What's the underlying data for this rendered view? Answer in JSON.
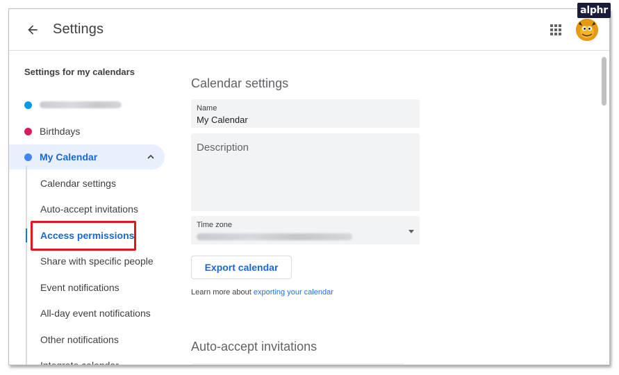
{
  "header": {
    "title": "Settings"
  },
  "sidebar": {
    "heading": "Settings for my calendars",
    "calendars": [
      {
        "label": "",
        "color": "#039be5",
        "blurred": true
      },
      {
        "label": "Birthdays",
        "color": "#d81b60",
        "blurred": false
      },
      {
        "label": "My Calendar",
        "color": "#4285f4",
        "blurred": false,
        "expanded": true
      }
    ],
    "sub_items": [
      "Calendar settings",
      "Auto-accept invitations",
      "Access permissions",
      "Share with specific people",
      "Event notifications",
      "All-day event notifications",
      "Other notifications",
      "Integrate calendar"
    ],
    "active_sub_item": "Access permissions"
  },
  "main": {
    "section_title": "Calendar settings",
    "name_field": {
      "label": "Name",
      "value": "My Calendar"
    },
    "description_field": {
      "placeholder": "Description"
    },
    "timezone_field": {
      "label": "Time zone",
      "value_blurred": true
    },
    "export_button": "Export calendar",
    "learn_more_prefix": "Learn more about",
    "learn_more_link": "exporting your calendar",
    "next_section_title": "Auto-accept invitations"
  },
  "watermark": "alphr",
  "colors": {
    "accent": "#1a73e8",
    "active_bg": "#e8f0fe",
    "highlight_box": "#e0161d"
  },
  "icons": {
    "back": "arrow-back-icon",
    "apps": "apps-grid-icon",
    "expand": "chevron-up-icon",
    "dropdown": "arrow-drop-down-icon"
  }
}
